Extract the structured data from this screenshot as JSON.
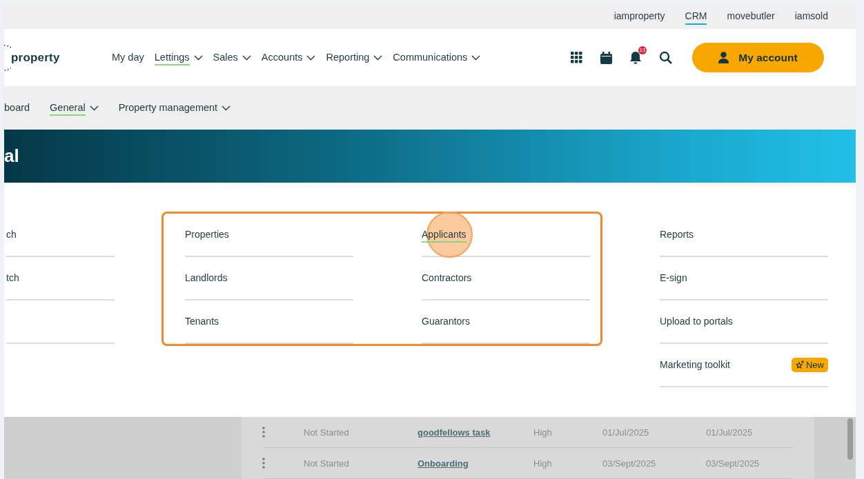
{
  "product_switcher": [
    {
      "label": "iamproperty",
      "selected": false
    },
    {
      "label": "CRM",
      "selected": true
    },
    {
      "label": "movebutler",
      "selected": false
    },
    {
      "label": "iamsold",
      "selected": false
    }
  ],
  "header": {
    "logo": "property",
    "nav": [
      {
        "label": "My day",
        "dropdown": false,
        "selected": false
      },
      {
        "label": "Lettings",
        "dropdown": true,
        "selected": true
      },
      {
        "label": "Sales",
        "dropdown": true,
        "selected": false
      },
      {
        "label": "Accounts",
        "dropdown": true,
        "selected": false
      },
      {
        "label": "Reporting",
        "dropdown": true,
        "selected": false
      },
      {
        "label": "Communications",
        "dropdown": true,
        "selected": false
      }
    ],
    "notification_count": "13",
    "account_button": "My account"
  },
  "subnav": [
    {
      "label": "board",
      "dropdown": false,
      "selected": false
    },
    {
      "label": "General",
      "dropdown": true,
      "selected": true
    },
    {
      "label": "Property management",
      "dropdown": true,
      "selected": false
    }
  ],
  "banner": {
    "title": "al"
  },
  "menu": {
    "groups": [
      {
        "highlighted": false,
        "columns": [
          [
            {
              "kind": "link",
              "label": "ch",
              "selected": false,
              "clicked": false
            },
            {
              "kind": "link",
              "label": "tch",
              "selected": false,
              "clicked": false
            },
            {
              "kind": "blank"
            }
          ]
        ]
      },
      {
        "highlighted": true,
        "columns": [
          [
            {
              "kind": "link",
              "label": "Properties",
              "selected": false,
              "clicked": false
            },
            {
              "kind": "link",
              "label": "Landlords",
              "selected": false,
              "clicked": false
            },
            {
              "kind": "link",
              "label": "Tenants",
              "selected": false,
              "clicked": false
            }
          ],
          [
            {
              "kind": "link",
              "label": "Applicants",
              "selected": true,
              "clicked": true
            },
            {
              "kind": "link",
              "label": "Contractors",
              "selected": false,
              "clicked": false
            },
            {
              "kind": "link",
              "label": "Guarantors",
              "selected": false,
              "clicked": false
            }
          ]
        ]
      },
      {
        "highlighted": false,
        "columns": [
          [
            {
              "kind": "link",
              "label": "Reports",
              "selected": false,
              "clicked": false
            },
            {
              "kind": "link",
              "label": "E-sign",
              "selected": false,
              "clicked": false
            },
            {
              "kind": "link",
              "label": "Upload to portals",
              "selected": false,
              "clicked": false
            },
            {
              "kind": "link",
              "label": "Marketing toolkit",
              "selected": false,
              "clicked": false,
              "badge": "New"
            }
          ]
        ]
      }
    ]
  },
  "background_table": {
    "rows": [
      {
        "status": "Not Started",
        "task": "goodfellows task",
        "priority": "High",
        "date_1": "01/Jul/2025",
        "date_2": "01/Jul/2025"
      },
      {
        "status": "Not Started",
        "task": "Onboarding",
        "priority": "High",
        "date_1": "03/Sept/2025",
        "date_2": "03/Sept/2025"
      }
    ]
  }
}
